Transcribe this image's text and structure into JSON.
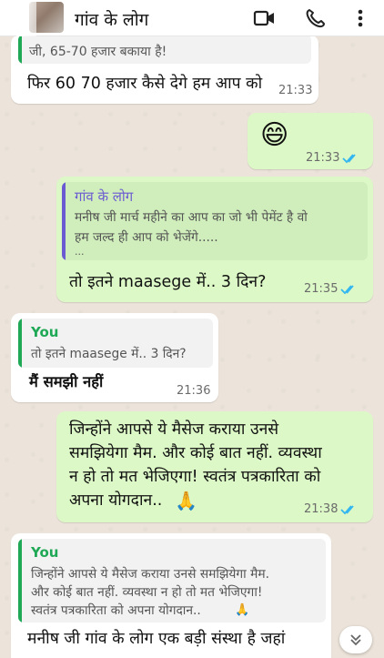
{
  "header": {
    "title": "गांव के लोग",
    "icons": [
      "video-call-icon",
      "voice-call-icon",
      "more-options-icon"
    ]
  },
  "messages": [
    {
      "kind": "incoming",
      "quote_partial": "जी, 65-70 हजार बकाया है!",
      "text": "फिर 60 70 हजार कैसे देगे हम आप को",
      "time": "21:33"
    },
    {
      "kind": "outgoing",
      "emoji": "😄",
      "time": "21:33",
      "status": "read"
    },
    {
      "kind": "outgoing",
      "quote_author": "गांव के लोग",
      "quote_line1": "मनीष जी मार्च महीने का आप का जो भी पेमेंट है वो",
      "quote_line2": "हम जल्द ही आप को भेजेंगे.....",
      "quote_more": "...",
      "text": "तो इतने maasege में.. 3 दिन?",
      "time": "21:35",
      "status": "read"
    },
    {
      "kind": "incoming",
      "quote_author": "You",
      "quote_line1": "तो इतने maasege में.. 3 दिन?",
      "text": "मैं समझी नहीं",
      "time": "21:36"
    },
    {
      "kind": "outgoing",
      "line1": "जिन्होंने आपसे ये मैसेज कराया उनसे",
      "line2": "समझियेगा मैम. और कोई बात नहीं. व्यवस्था",
      "line3": "न हो तो मत भेजिएगा! स्वतंत्र पत्रकारिता को",
      "line4": "अपना योगदान..",
      "emoji": "🙏",
      "time": "21:38",
      "status": "read"
    },
    {
      "kind": "incoming",
      "quote_author": "You",
      "quote_line1": "जिन्होंने आपसे ये मैसेज कराया उनसे समझियेगा मैम.",
      "quote_line2": "और कोई बात नहीं. व्यवस्था न हो तो मत भेजिएगा!",
      "quote_line3": "स्वतंत्र पत्रकारिता को अपना योगदान..",
      "quote_emoji": "🙏",
      "line1": "मनीष जी गांव के लोग एक बड़ी संस्था है जहां",
      "line2": "..."
    }
  ],
  "colors": {
    "outgoing_bubble": "#dcf8c6",
    "incoming_bubble": "#ffffff",
    "quote_you": "#1fa855",
    "quote_group": "#6b5bd2",
    "read_ticks": "#34b7f1"
  }
}
